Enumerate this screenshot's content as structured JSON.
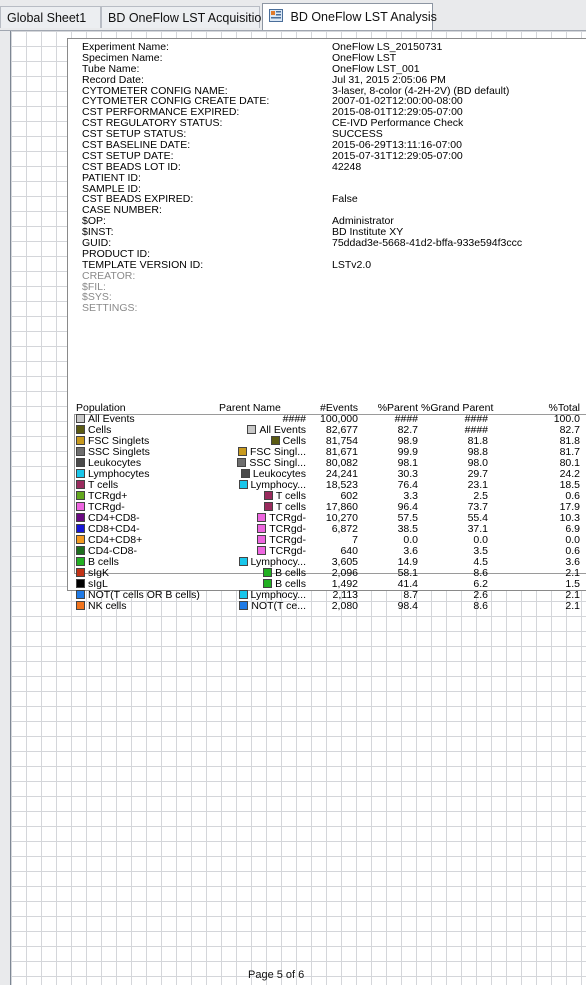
{
  "tabs": [
    {
      "label": "Global Sheet1"
    },
    {
      "label": "BD OneFlow LST Acquisition"
    },
    {
      "label": "BD OneFlow LST Analysis",
      "active": true
    }
  ],
  "meta": [
    {
      "key": "Experiment Name:",
      "value": "OneFlow LS_20150731"
    },
    {
      "key": "Specimen Name:",
      "value": "OneFlow LST"
    },
    {
      "key": "Tube Name:",
      "value": "OneFlow LST_001"
    },
    {
      "key": "Record Date:",
      "value": "Jul 31, 2015 2:05:06 PM"
    },
    {
      "key": "CYTOMETER CONFIG NAME:",
      "value": "3-laser, 8-color (4-2H-2V) (BD default)"
    },
    {
      "key": "CYTOMETER CONFIG CREATE DATE:",
      "value": "2007-01-02T12:00:00-08:00"
    },
    {
      "key": "CST PERFORMANCE EXPIRED:",
      "value": "2015-08-01T12:29:05-07:00"
    },
    {
      "key": "CST REGULATORY STATUS:",
      "value": "CE-IVD Performance Check"
    },
    {
      "key": "CST SETUP STATUS:",
      "value": "SUCCESS"
    },
    {
      "key": "CST BASELINE DATE:",
      "value": "2015-06-29T13:11:16-07:00"
    },
    {
      "key": "CST SETUP DATE:",
      "value": "2015-07-31T12:29:05-07:00"
    },
    {
      "key": "CST BEADS LOT ID:",
      "value": "42248"
    },
    {
      "key": "PATIENT ID:",
      "value": ""
    },
    {
      "key": "SAMPLE ID:",
      "value": ""
    },
    {
      "key": "CST BEADS EXPIRED:",
      "value": "False"
    },
    {
      "key": "CASE NUMBER:",
      "value": ""
    },
    {
      "key": "$OP:",
      "value": "Administrator"
    },
    {
      "key": "$INST:",
      "value": "BD Institute XY"
    },
    {
      "key": "GUID:",
      "value": "75ddad3e-5668-41d2-bffa-933e594f3ccc"
    },
    {
      "key": "PRODUCT ID:",
      "value": ""
    },
    {
      "key": "TEMPLATE VERSION ID:",
      "value": "LSTv2.0"
    },
    {
      "key": "CREATOR:",
      "value": "",
      "gray": true
    },
    {
      "key": "$FIL:",
      "value": "",
      "gray": true
    },
    {
      "key": "$SYS:",
      "value": "",
      "gray": true
    },
    {
      "key": "SETTINGS:",
      "value": "",
      "gray": true
    }
  ],
  "table": {
    "headers": {
      "population": "Population",
      "parent": "Parent Name",
      "events": "#Events",
      "pct_parent": "%Parent",
      "pct_grand": "%Grand Parent",
      "pct_total": "%Total"
    },
    "rows": [
      {
        "pop": "All Events",
        "color": "#c8c8c8",
        "parent": "####",
        "parent_color": null,
        "events": "100,000",
        "pp": "####",
        "gp": "####",
        "tot": "100.0"
      },
      {
        "pop": "Cells",
        "color": "#5a5a12",
        "parent": "All Events",
        "parent_color": "#c8c8c8",
        "events": "82,677",
        "pp": "82.7",
        "gp": "####",
        "tot": "82.7"
      },
      {
        "pop": "FSC Singlets",
        "color": "#c89a1e",
        "parent": "Cells",
        "parent_color": "#5a5a12",
        "events": "81,754",
        "pp": "98.9",
        "gp": "81.8",
        "tot": "81.8"
      },
      {
        "pop": "SSC Singlets",
        "color": "#6e6e6e",
        "parent": "FSC Singl...",
        "parent_color": "#c89a1e",
        "events": "81,671",
        "pp": "99.9",
        "gp": "98.8",
        "tot": "81.7"
      },
      {
        "pop": "Leukocytes",
        "color": "#4a4a4a",
        "parent": "SSC Singl...",
        "parent_color": "#6e6e6e",
        "events": "80,082",
        "pp": "98.1",
        "gp": "98.0",
        "tot": "80.1"
      },
      {
        "pop": "Lymphocytes",
        "color": "#19c6ea",
        "parent": "Leukocytes",
        "parent_color": "#4a4a4a",
        "events": "24,241",
        "pp": "30.3",
        "gp": "29.7",
        "tot": "24.2"
      },
      {
        "pop": "T cells",
        "color": "#9a2b5e",
        "parent": "Lymphocy...",
        "parent_color": "#19c6ea",
        "events": "18,523",
        "pp": "76.4",
        "gp": "23.1",
        "tot": "18.5"
      },
      {
        "pop": "TCRgd+",
        "color": "#63a81e",
        "parent": "T cells",
        "parent_color": "#9a2b5e",
        "events": "602",
        "pp": "3.3",
        "gp": "2.5",
        "tot": "0.6"
      },
      {
        "pop": "TCRgd-",
        "color": "#ee66e0",
        "parent": "T cells",
        "parent_color": "#9a2b5e",
        "events": "17,860",
        "pp": "96.4",
        "gp": "73.7",
        "tot": "17.9"
      },
      {
        "pop": "CD4+CD8-",
        "color": "#6a0a82",
        "parent": "TCRgd-",
        "parent_color": "#ee66e0",
        "events": "10,270",
        "pp": "57.5",
        "gp": "55.4",
        "tot": "10.3"
      },
      {
        "pop": "CD8+CD4-",
        "color": "#1616d8",
        "parent": "TCRgd-",
        "parent_color": "#ee66e0",
        "events": "6,872",
        "pp": "38.5",
        "gp": "37.1",
        "tot": "6.9"
      },
      {
        "pop": "CD4+CD8+",
        "color": "#f39a1e",
        "parent": "TCRgd-",
        "parent_color": "#ee66e0",
        "events": "7",
        "pp": "0.0",
        "gp": "0.0",
        "tot": "0.0"
      },
      {
        "pop": "CD4-CD8-",
        "color": "#1e6e1e",
        "parent": "TCRgd-",
        "parent_color": "#ee66e0",
        "events": "640",
        "pp": "3.6",
        "gp": "3.5",
        "tot": "0.6"
      },
      {
        "pop": "B cells",
        "color": "#22b022",
        "parent": "Lymphocy...",
        "parent_color": "#19c6ea",
        "events": "3,605",
        "pp": "14.9",
        "gp": "4.5",
        "tot": "3.6"
      },
      {
        "pop": "sIgK",
        "color": "#c23216",
        "parent": "B cells",
        "parent_color": "#22b022",
        "events": "2,096",
        "pp": "58.1",
        "gp": "8.6",
        "tot": "2.1"
      },
      {
        "pop": "sIgL",
        "color": "#000000",
        "parent": "B cells",
        "parent_color": "#22b022",
        "events": "1,492",
        "pp": "41.4",
        "gp": "6.2",
        "tot": "1.5"
      },
      {
        "pop": "NOT(T cells OR B cells)",
        "color": "#1e7ae6",
        "parent": "Lymphocy...",
        "parent_color": "#19c6ea",
        "events": "2,113",
        "pp": "8.7",
        "gp": "2.6",
        "tot": "2.1"
      },
      {
        "pop": "NK cells",
        "color": "#f0741e",
        "parent": "NOT(T ce...",
        "parent_color": "#1e7ae6",
        "events": "2,080",
        "pp": "98.4",
        "gp": "8.6",
        "tot": "2.1"
      }
    ]
  },
  "footer": {
    "page": "Page 5 of 6"
  }
}
